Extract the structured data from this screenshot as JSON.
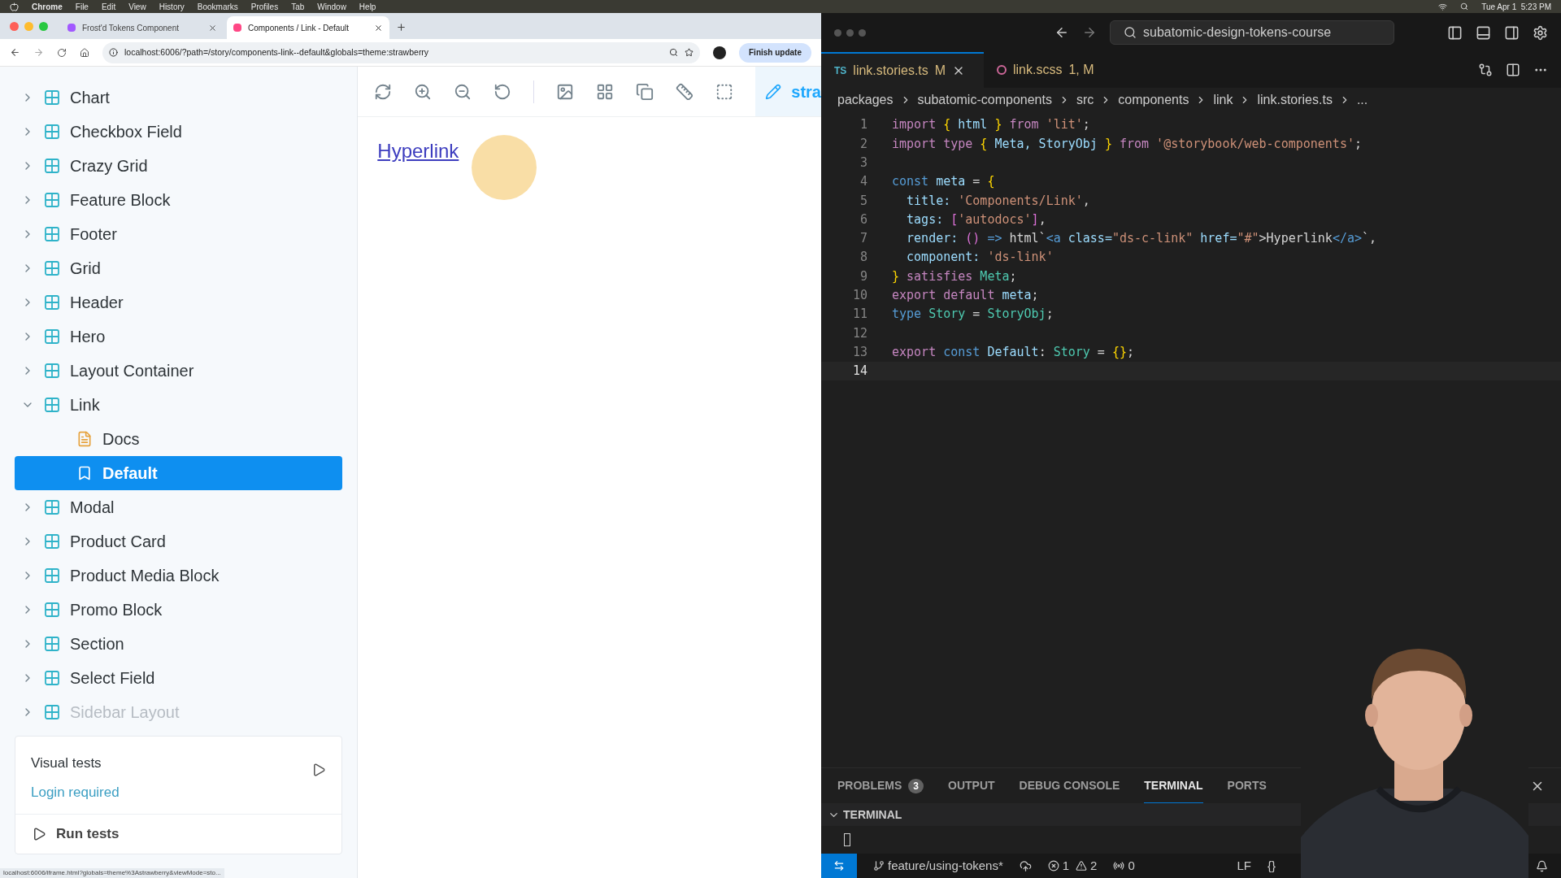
{
  "menu_bar": {
    "app": "Chrome",
    "items": [
      "File",
      "Edit",
      "View",
      "History",
      "Bookmarks",
      "Profiles",
      "Tab",
      "Window",
      "Help"
    ],
    "clock": "Tue Apr 1  5:23 PM"
  },
  "browser": {
    "tabs": [
      {
        "title": "Frost'd Tokens Component",
        "selected": false
      },
      {
        "title": "Components / Link - Default",
        "selected": true
      }
    ],
    "url": "localhost:6006/?path=/story/components-link--default&globals=theme:strawberry",
    "update_button": "Finish update",
    "status_url": "localhost:6006/iframe.html?globals=theme%3Astrawberry&viewMode=sto..."
  },
  "sidebar": {
    "items": [
      {
        "label": "Chart",
        "kind": "component",
        "expanded": false,
        "faded": false
      },
      {
        "label": "Checkbox Field",
        "kind": "component",
        "expanded": false,
        "faded": false
      },
      {
        "label": "Crazy Grid",
        "kind": "component",
        "expanded": false,
        "faded": false
      },
      {
        "label": "Feature Block",
        "kind": "component",
        "expanded": false,
        "faded": false
      },
      {
        "label": "Footer",
        "kind": "component",
        "expanded": false,
        "faded": false
      },
      {
        "label": "Grid",
        "kind": "component",
        "expanded": false,
        "faded": false
      },
      {
        "label": "Header",
        "kind": "component",
        "expanded": false,
        "faded": false
      },
      {
        "label": "Hero",
        "kind": "component",
        "expanded": false,
        "faded": false
      },
      {
        "label": "Layout Container",
        "kind": "component",
        "expanded": false,
        "faded": false
      },
      {
        "label": "Link",
        "kind": "component",
        "expanded": true,
        "faded": false,
        "children": [
          {
            "label": "Docs",
            "kind": "doc",
            "selected": false
          },
          {
            "label": "Default",
            "kind": "story",
            "selected": true
          }
        ]
      },
      {
        "label": "Modal",
        "kind": "component",
        "expanded": false,
        "faded": false
      },
      {
        "label": "Product Card",
        "kind": "component",
        "expanded": false,
        "faded": false
      },
      {
        "label": "Product Media Block",
        "kind": "component",
        "expanded": false,
        "faded": false
      },
      {
        "label": "Promo Block",
        "kind": "component",
        "expanded": false,
        "faded": false
      },
      {
        "label": "Section",
        "kind": "component",
        "expanded": false,
        "faded": false
      },
      {
        "label": "Select Field",
        "kind": "component",
        "expanded": false,
        "faded": false
      },
      {
        "label": "Sidebar Layout",
        "kind": "component",
        "expanded": false,
        "faded": true
      }
    ],
    "visual_tests": {
      "title": "Visual tests",
      "link": "Login required",
      "run": "Run tests"
    }
  },
  "canvas": {
    "toolbar_cut_label": "stra",
    "link": "Hyperlink"
  },
  "editor": {
    "search": "subatomic-design-tokens-course",
    "tabs": [
      {
        "badge": "TS",
        "name": "link.stories.ts",
        "status": "M",
        "selected": true
      },
      {
        "name": "link.scss",
        "status": "1, M",
        "selected": false
      }
    ],
    "breadcrumbs": [
      "packages",
      "subatomic-components",
      "src",
      "components",
      "link",
      "link.stories.ts",
      "..."
    ],
    "lines": [
      {
        "number": "1",
        "current": false,
        "tokens": [
          {
            "text": "import",
            "kind": "keyword"
          },
          {
            "text": " { ",
            "kind": "brace"
          },
          {
            "text": "html",
            "kind": "variable"
          },
          {
            "text": " } ",
            "kind": "brace"
          },
          {
            "text": "from",
            "kind": "keyword"
          },
          {
            "text": " 'lit'",
            "kind": "string"
          },
          {
            "text": ";",
            "kind": "plain"
          }
        ]
      },
      {
        "number": "2",
        "current": false,
        "tokens": [
          {
            "text": "import",
            "kind": "keyword"
          },
          {
            "text": " type",
            "kind": "keyword"
          },
          {
            "text": " { ",
            "kind": "brace"
          },
          {
            "text": "Meta, StoryObj",
            "kind": "variable"
          },
          {
            "text": " } ",
            "kind": "brace"
          },
          {
            "text": "from",
            "kind": "keyword"
          },
          {
            "text": " '@storybook/web-components'",
            "kind": "string"
          },
          {
            "text": ";",
            "kind": "plain"
          }
        ]
      },
      {
        "number": "3",
        "current": false
      },
      {
        "number": "4",
        "current": false,
        "tokens": [
          {
            "text": "const",
            "kind": "declaration"
          },
          {
            "text": " meta",
            "kind": "variable"
          },
          {
            "text": " = ",
            "kind": "plain"
          },
          {
            "text": "{",
            "kind": "brace"
          }
        ]
      },
      {
        "number": "5",
        "current": false,
        "tokens": [
          {
            "text": "  title: ",
            "kind": "variable"
          },
          {
            "text": "'Components/Link'",
            "kind": "string"
          },
          {
            "text": ",",
            "kind": "plain"
          }
        ]
      },
      {
        "number": "6",
        "current": false,
        "tokens": [
          {
            "text": "  tags: ",
            "kind": "variable"
          },
          {
            "text": "[",
            "kind": "bracket"
          },
          {
            "text": "'autodocs'",
            "kind": "string"
          },
          {
            "text": "]",
            "kind": "bracket"
          },
          {
            "text": ",",
            "kind": "plain"
          }
        ]
      },
      {
        "number": "7",
        "current": false,
        "tokens": [
          {
            "text": "  render: ",
            "kind": "variable"
          },
          {
            "text": "()",
            "kind": "bracket"
          },
          {
            "text": " => ",
            "kind": "declaration"
          },
          {
            "text": "html`",
            "kind": "plain"
          },
          {
            "text": "<a",
            "kind": "declaration"
          },
          {
            "text": " class=",
            "kind": "variable"
          },
          {
            "text": "\"ds-c-link\"",
            "kind": "string"
          },
          {
            "text": " href=",
            "kind": "variable"
          },
          {
            "text": "\"#\"",
            "kind": "string"
          },
          {
            "text": ">Hyperlink",
            "kind": "plain"
          },
          {
            "text": "</a>",
            "kind": "declaration"
          },
          {
            "text": "`,",
            "kind": "plain"
          }
        ]
      },
      {
        "number": "8",
        "current": false,
        "tokens": [
          {
            "text": "  component: ",
            "kind": "variable"
          },
          {
            "text": "'ds-link'",
            "kind": "string"
          }
        ]
      },
      {
        "number": "9",
        "current": false,
        "tokens": [
          {
            "text": "}",
            "kind": "brace"
          },
          {
            "text": " satisfies",
            "kind": "keyword"
          },
          {
            "text": " Meta",
            "kind": "type"
          },
          {
            "text": ";",
            "kind": "plain"
          }
        ]
      },
      {
        "number": "10",
        "current": false,
        "tokens": [
          {
            "text": "export default",
            "kind": "keyword"
          },
          {
            "text": " meta",
            "kind": "variable"
          },
          {
            "text": ";",
            "kind": "plain"
          }
        ]
      },
      {
        "number": "11",
        "current": false,
        "tokens": [
          {
            "text": "type",
            "kind": "declaration"
          },
          {
            "text": " Story",
            "kind": "type"
          },
          {
            "text": " = ",
            "kind": "plain"
          },
          {
            "text": "StoryObj",
            "kind": "type"
          },
          {
            "text": ";",
            "kind": "plain"
          }
        ]
      },
      {
        "number": "12",
        "current": false
      },
      {
        "number": "13",
        "current": false,
        "tokens": [
          {
            "text": "export",
            "kind": "keyword"
          },
          {
            "text": " const",
            "kind": "declaration"
          },
          {
            "text": " Default",
            "kind": "variable"
          },
          {
            "text": ": ",
            "kind": "plain"
          },
          {
            "text": "Story",
            "kind": "type"
          },
          {
            "text": " = ",
            "kind": "plain"
          },
          {
            "text": "{}",
            "kind": "brace"
          },
          {
            "text": ";",
            "kind": "plain"
          }
        ]
      },
      {
        "number": "14",
        "current": true
      }
    ],
    "panel_tabs": [
      {
        "label": "PROBLEMS",
        "count": "3",
        "selected": false
      },
      {
        "label": "OUTPUT",
        "selected": false
      },
      {
        "label": "DEBUG CONSOLE",
        "selected": false
      },
      {
        "label": "TERMINAL",
        "selected": true
      },
      {
        "label": "PORTS",
        "selected": false
      }
    ],
    "terminal_title": "TERMINAL",
    "status": {
      "branch": "feature/using-tokens*",
      "errors": "1",
      "warnings": "2",
      "ports": "0",
      "eol": "LF",
      "lang": "{}"
    }
  }
}
